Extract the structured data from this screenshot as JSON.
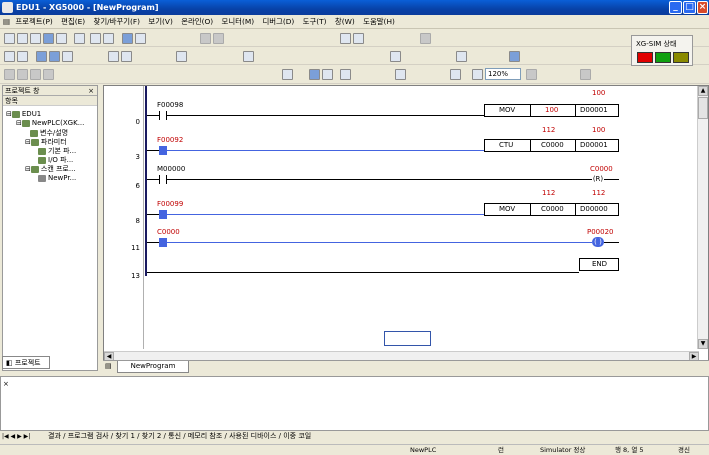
{
  "window": {
    "title": "EDU1 - XG5000 - [NewProgram]"
  },
  "menu": [
    "프로젝트(P)",
    "편집(E)",
    "찾기/바꾸기(F)",
    "보기(V)",
    "온라인(O)",
    "모니터(M)",
    "디버그(D)",
    "도구(T)",
    "창(W)",
    "도움말(H)"
  ],
  "toolbar": {
    "zoom": "120%"
  },
  "sim": {
    "label": "XG-SIM 상태",
    "leds": [
      "#e00000",
      "#10a010",
      "#8a8a00"
    ]
  },
  "project": {
    "title": "프로젝트 창",
    "column": "항목",
    "tree": [
      "EDU1",
      "NewPLC(XGK...",
      "변수/설명",
      "파라미터",
      "기본 파...",
      "I/O 파...",
      "스캔 프로...",
      "NewPr..."
    ],
    "tab": "프로젝트"
  },
  "ladder": {
    "rungs": [
      {
        "step": "0",
        "contact": "F00098",
        "fn": "MOV",
        "op1": "100",
        "op2": "D00001",
        "pv": [
          "",
          "100"
        ]
      },
      {
        "step": "3",
        "contact": "F00092",
        "fn": "CTU",
        "op1": "C0000",
        "op2": "D00001",
        "pv": [
          "112",
          "100"
        ]
      },
      {
        "step": "6",
        "contact": "M00000",
        "coil": "C0000",
        "coil_type": "(R)"
      },
      {
        "step": "8",
        "contact": "F00099",
        "fn": "MOV",
        "op1": "C0000",
        "op2": "D00000",
        "pv": [
          "112",
          "112"
        ]
      },
      {
        "step": "11",
        "contact": "C0000",
        "coil": "P00020",
        "coil_type": "( )"
      },
      {
        "step": "13",
        "fn": "END"
      }
    ]
  },
  "doc_tab": "NewProgram",
  "output_tabs": [
    "결과",
    "프로그램 검사",
    "찾기 1",
    "찾기 2",
    "통신",
    "메모리 참조",
    "사용된 디바이스",
    "이중 코일"
  ],
  "status": {
    "plc": "NewPLC",
    "mode": "런",
    "sim": "Simulator 정상",
    "pos": "행 8, 열 5",
    "warn": "경신"
  }
}
